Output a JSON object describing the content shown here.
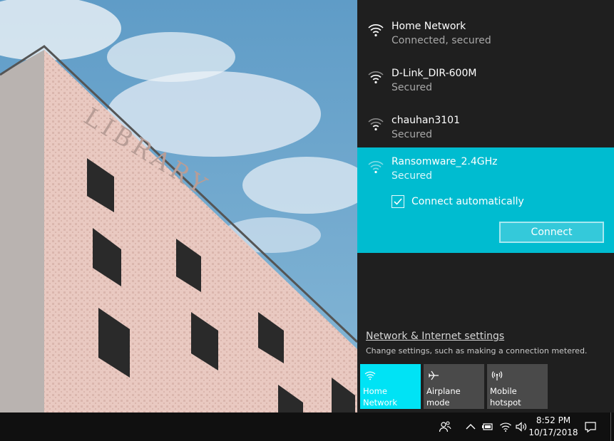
{
  "flyout": {
    "networks": [
      {
        "name": "Home Network",
        "status": "Connected, secured"
      },
      {
        "name": "D-Link_DIR-600M",
        "status": "Secured"
      },
      {
        "name": "chauhan3101",
        "status": "Secured"
      }
    ],
    "selected": {
      "name": "Ransomware_2.4GHz",
      "status": "Secured",
      "auto_connect_label": "Connect automatically",
      "auto_connect_checked": true,
      "connect_label": "Connect"
    },
    "settings_link": "Network & Internet settings",
    "settings_desc": "Change settings, such as making a connection metered.",
    "tiles": [
      {
        "label": "Home\nNetwork",
        "icon": "wifi-icon",
        "active": true
      },
      {
        "label": "Airplane mode",
        "icon": "airplane-icon",
        "active": false
      },
      {
        "label": "Mobile\nhotspot",
        "icon": "hotspot-icon",
        "active": false
      }
    ]
  },
  "taskbar": {
    "time": "8:52 PM",
    "date": "10/17/2018",
    "tray_icons": [
      "people-icon",
      "chevron-up-icon",
      "battery-icon",
      "wifi-icon",
      "volume-icon",
      "action-center-icon"
    ]
  },
  "wallpaper": {
    "sign_text": "LIBRARY"
  },
  "colors": {
    "accent": "#00bcd0",
    "tile_active": "#00e3f5",
    "flyout_bg": "#1f1f1f",
    "taskbar_bg": "#101010"
  }
}
